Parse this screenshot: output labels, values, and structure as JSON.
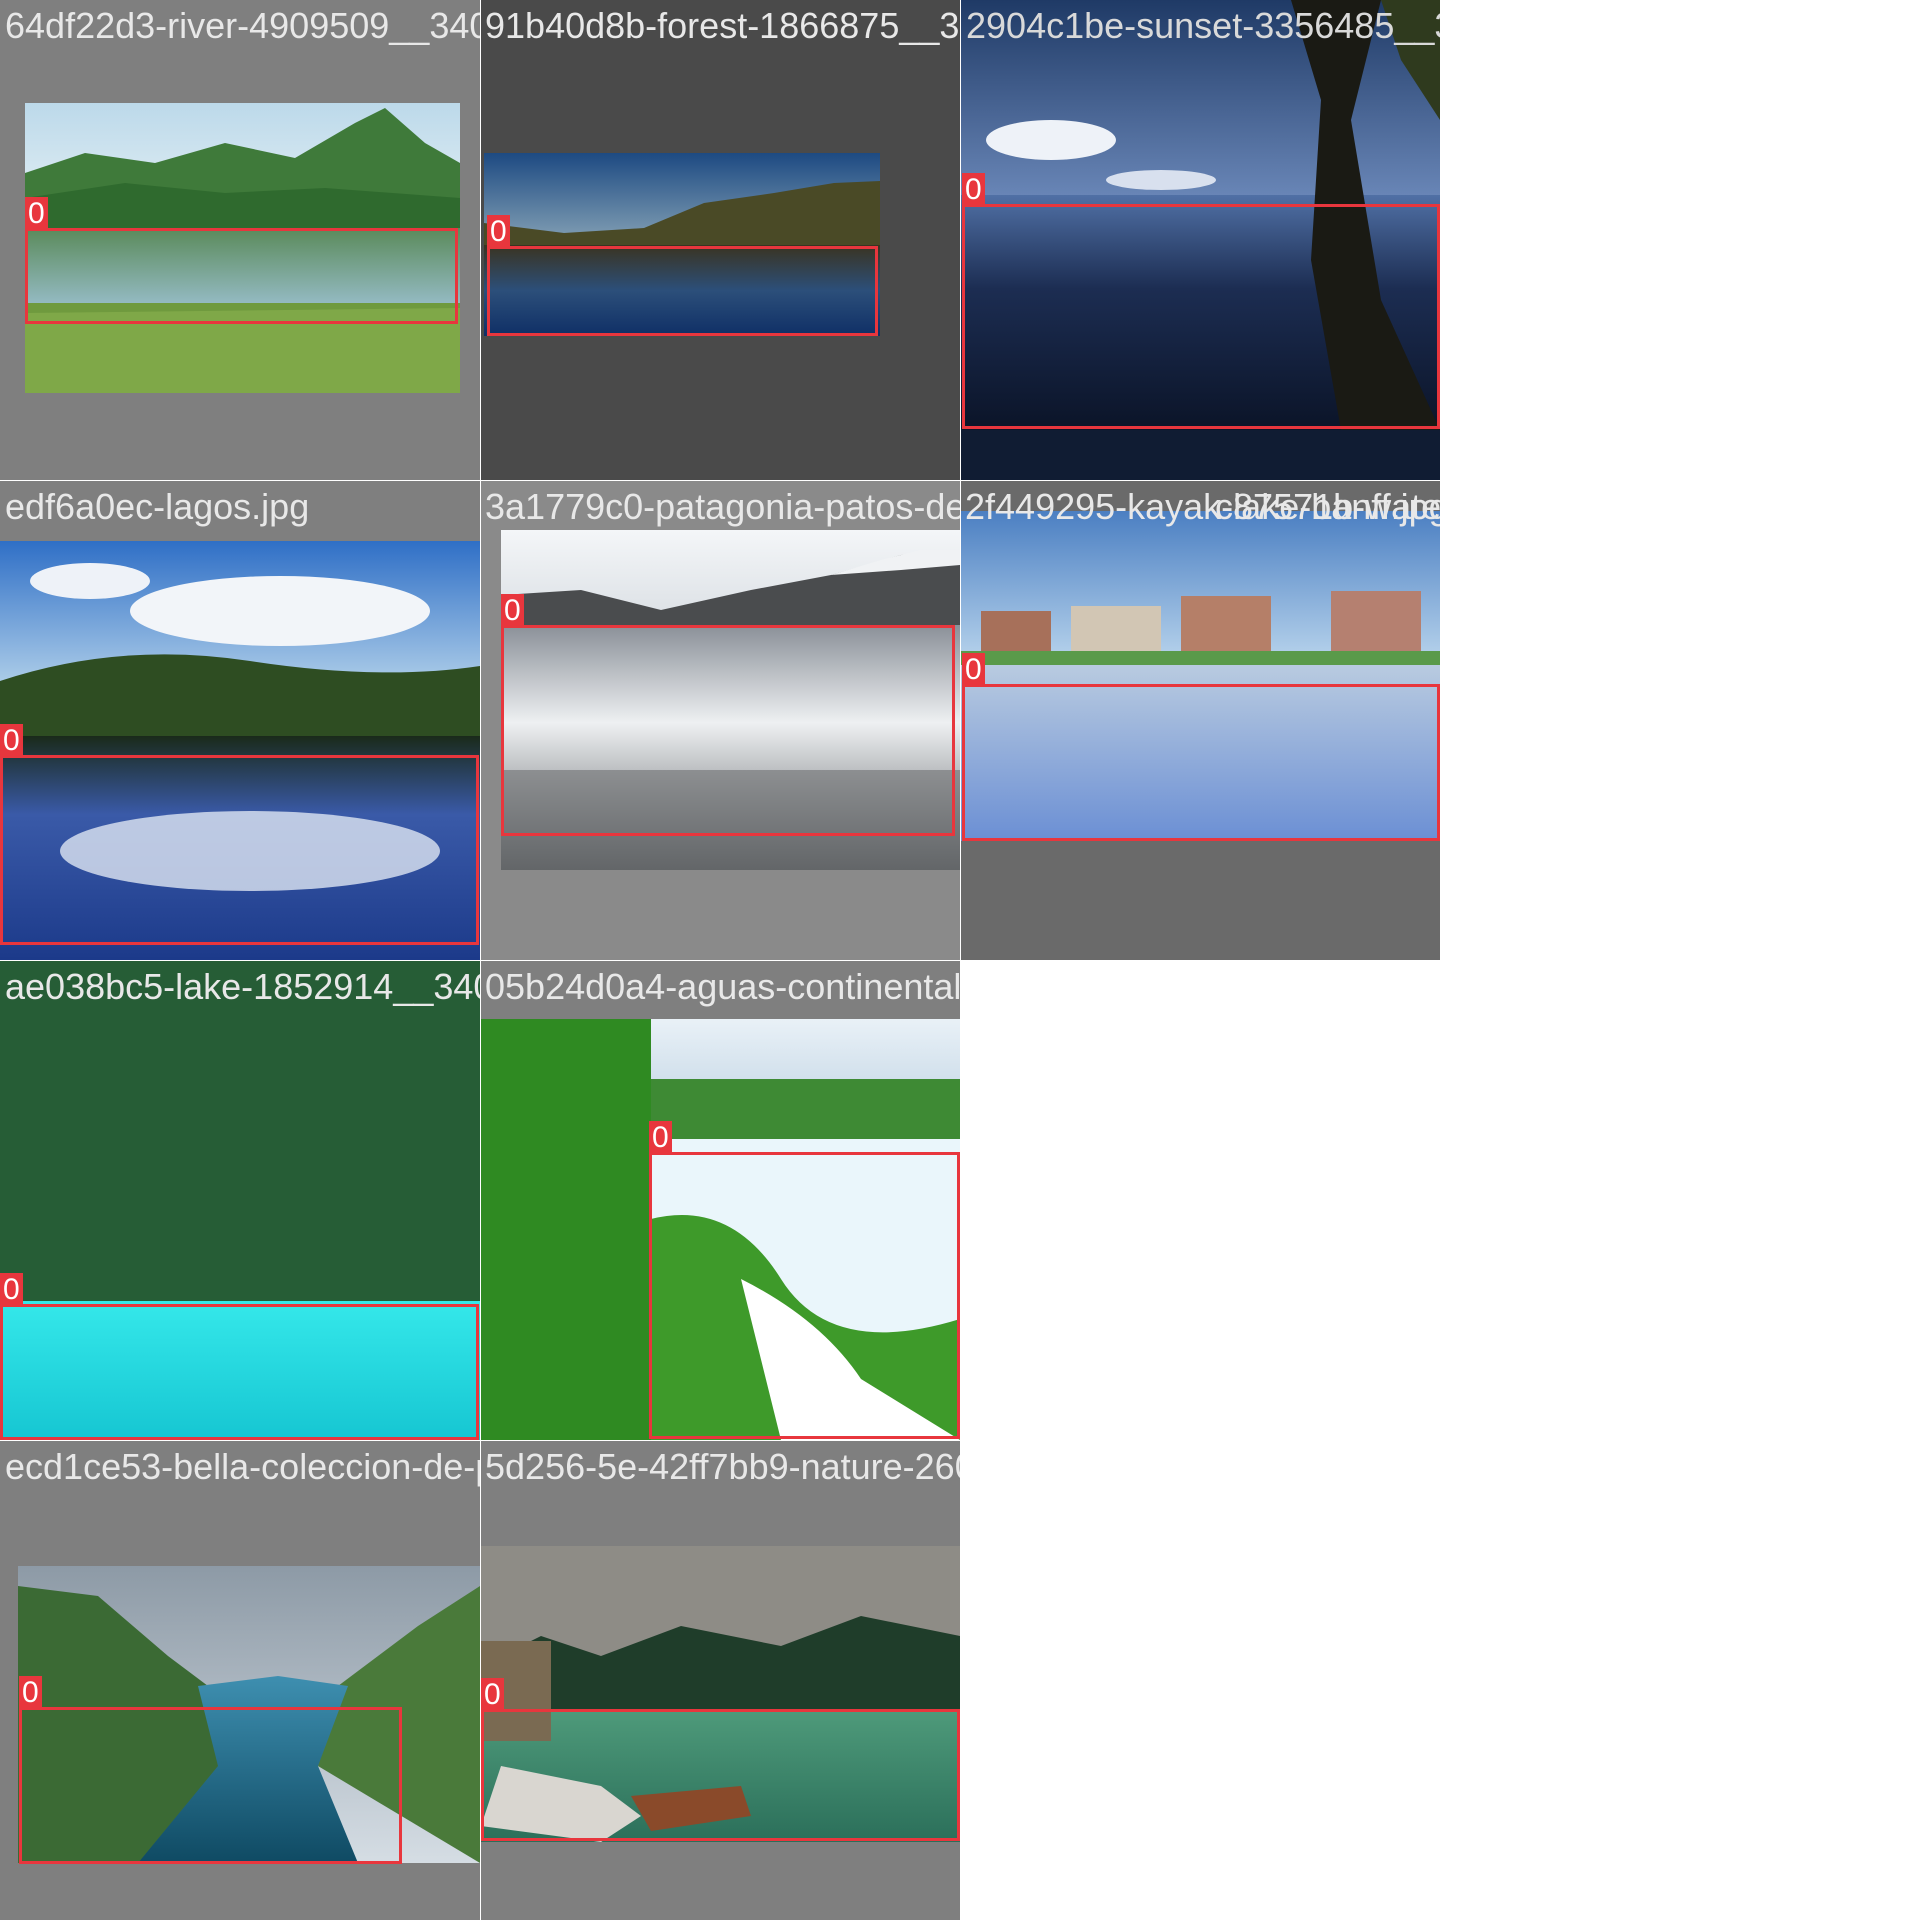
{
  "mosaic": {
    "class_label": "0",
    "tiles": [
      {
        "filename": "64df22d3-river-4909509__340.jpg"
      },
      {
        "filename": "91b40d8b-forest-1866875__340.jpg"
      },
      {
        "filename": "2904c1be-sunset-3356485__340.jpg"
      },
      {
        "filename": "edf6a0ec-lagos.jpg"
      },
      {
        "filename": "3a1779c0-patagonia-patos-de-lago.jpg"
      },
      {
        "filename": "2f449295-kayak-lake-banff.jpg"
      },
      {
        "filename": "c87571b-water-3334482__340.jpg"
      },
      {
        "filename": "ae038bc5-lake-1852914__340.jpg"
      },
      {
        "filename": "05b24d0a4-aguas-continentales.jpg"
      },
      {
        "filename": "ecd1ce53-bella-coleccion-de-paisajes-hermosos.jpg"
      },
      {
        "filename": "5d256-5e-42ff7bb9-nature-2609850__340.jpg"
      }
    ]
  },
  "colors": {
    "box": "#e8363d",
    "tile_gray": "#808080",
    "tile_dark": "#4a4a4a"
  }
}
